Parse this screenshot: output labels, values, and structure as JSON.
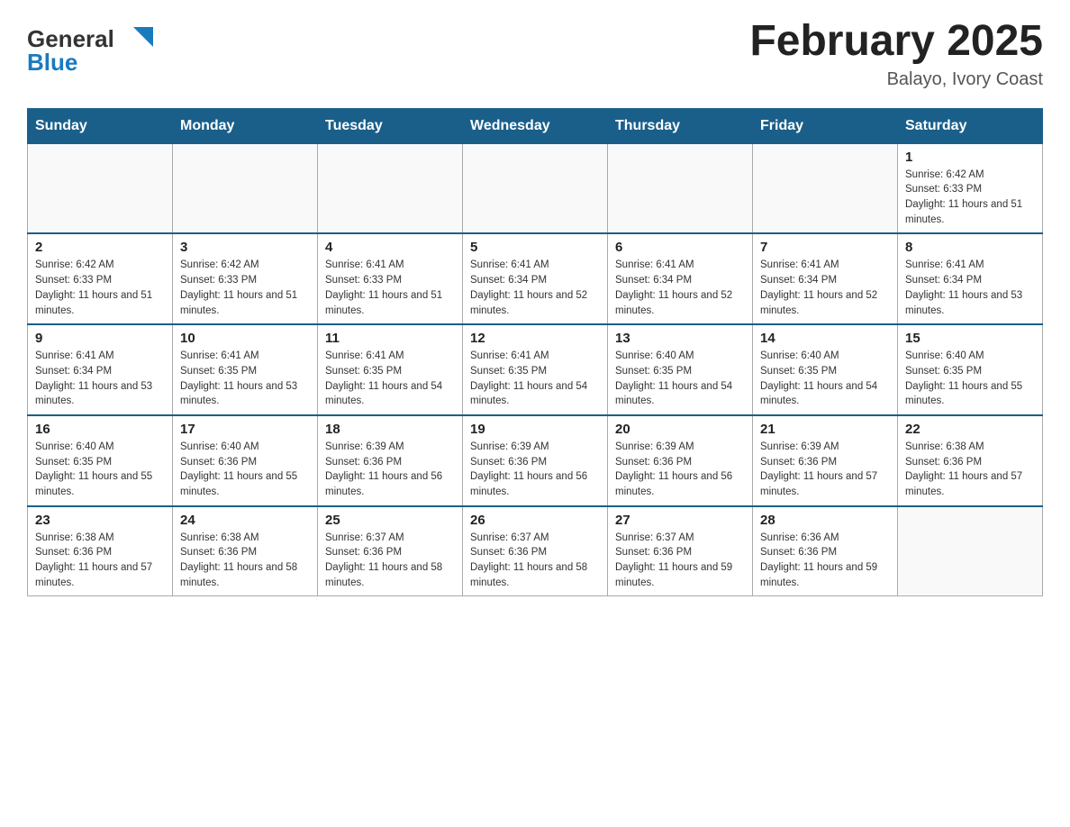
{
  "header": {
    "logo_general": "General",
    "logo_blue": "Blue",
    "month_title": "February 2025",
    "location": "Balayo, Ivory Coast"
  },
  "days_of_week": [
    "Sunday",
    "Monday",
    "Tuesday",
    "Wednesday",
    "Thursday",
    "Friday",
    "Saturday"
  ],
  "weeks": [
    [
      {
        "day": "",
        "sunrise": "",
        "sunset": "",
        "daylight": ""
      },
      {
        "day": "",
        "sunrise": "",
        "sunset": "",
        "daylight": ""
      },
      {
        "day": "",
        "sunrise": "",
        "sunset": "",
        "daylight": ""
      },
      {
        "day": "",
        "sunrise": "",
        "sunset": "",
        "daylight": ""
      },
      {
        "day": "",
        "sunrise": "",
        "sunset": "",
        "daylight": ""
      },
      {
        "day": "",
        "sunrise": "",
        "sunset": "",
        "daylight": ""
      },
      {
        "day": "1",
        "sunrise": "Sunrise: 6:42 AM",
        "sunset": "Sunset: 6:33 PM",
        "daylight": "Daylight: 11 hours and 51 minutes."
      }
    ],
    [
      {
        "day": "2",
        "sunrise": "Sunrise: 6:42 AM",
        "sunset": "Sunset: 6:33 PM",
        "daylight": "Daylight: 11 hours and 51 minutes."
      },
      {
        "day": "3",
        "sunrise": "Sunrise: 6:42 AM",
        "sunset": "Sunset: 6:33 PM",
        "daylight": "Daylight: 11 hours and 51 minutes."
      },
      {
        "day": "4",
        "sunrise": "Sunrise: 6:41 AM",
        "sunset": "Sunset: 6:33 PM",
        "daylight": "Daylight: 11 hours and 51 minutes."
      },
      {
        "day": "5",
        "sunrise": "Sunrise: 6:41 AM",
        "sunset": "Sunset: 6:34 PM",
        "daylight": "Daylight: 11 hours and 52 minutes."
      },
      {
        "day": "6",
        "sunrise": "Sunrise: 6:41 AM",
        "sunset": "Sunset: 6:34 PM",
        "daylight": "Daylight: 11 hours and 52 minutes."
      },
      {
        "day": "7",
        "sunrise": "Sunrise: 6:41 AM",
        "sunset": "Sunset: 6:34 PM",
        "daylight": "Daylight: 11 hours and 52 minutes."
      },
      {
        "day": "8",
        "sunrise": "Sunrise: 6:41 AM",
        "sunset": "Sunset: 6:34 PM",
        "daylight": "Daylight: 11 hours and 53 minutes."
      }
    ],
    [
      {
        "day": "9",
        "sunrise": "Sunrise: 6:41 AM",
        "sunset": "Sunset: 6:34 PM",
        "daylight": "Daylight: 11 hours and 53 minutes."
      },
      {
        "day": "10",
        "sunrise": "Sunrise: 6:41 AM",
        "sunset": "Sunset: 6:35 PM",
        "daylight": "Daylight: 11 hours and 53 minutes."
      },
      {
        "day": "11",
        "sunrise": "Sunrise: 6:41 AM",
        "sunset": "Sunset: 6:35 PM",
        "daylight": "Daylight: 11 hours and 54 minutes."
      },
      {
        "day": "12",
        "sunrise": "Sunrise: 6:41 AM",
        "sunset": "Sunset: 6:35 PM",
        "daylight": "Daylight: 11 hours and 54 minutes."
      },
      {
        "day": "13",
        "sunrise": "Sunrise: 6:40 AM",
        "sunset": "Sunset: 6:35 PM",
        "daylight": "Daylight: 11 hours and 54 minutes."
      },
      {
        "day": "14",
        "sunrise": "Sunrise: 6:40 AM",
        "sunset": "Sunset: 6:35 PM",
        "daylight": "Daylight: 11 hours and 54 minutes."
      },
      {
        "day": "15",
        "sunrise": "Sunrise: 6:40 AM",
        "sunset": "Sunset: 6:35 PM",
        "daylight": "Daylight: 11 hours and 55 minutes."
      }
    ],
    [
      {
        "day": "16",
        "sunrise": "Sunrise: 6:40 AM",
        "sunset": "Sunset: 6:35 PM",
        "daylight": "Daylight: 11 hours and 55 minutes."
      },
      {
        "day": "17",
        "sunrise": "Sunrise: 6:40 AM",
        "sunset": "Sunset: 6:36 PM",
        "daylight": "Daylight: 11 hours and 55 minutes."
      },
      {
        "day": "18",
        "sunrise": "Sunrise: 6:39 AM",
        "sunset": "Sunset: 6:36 PM",
        "daylight": "Daylight: 11 hours and 56 minutes."
      },
      {
        "day": "19",
        "sunrise": "Sunrise: 6:39 AM",
        "sunset": "Sunset: 6:36 PM",
        "daylight": "Daylight: 11 hours and 56 minutes."
      },
      {
        "day": "20",
        "sunrise": "Sunrise: 6:39 AM",
        "sunset": "Sunset: 6:36 PM",
        "daylight": "Daylight: 11 hours and 56 minutes."
      },
      {
        "day": "21",
        "sunrise": "Sunrise: 6:39 AM",
        "sunset": "Sunset: 6:36 PM",
        "daylight": "Daylight: 11 hours and 57 minutes."
      },
      {
        "day": "22",
        "sunrise": "Sunrise: 6:38 AM",
        "sunset": "Sunset: 6:36 PM",
        "daylight": "Daylight: 11 hours and 57 minutes."
      }
    ],
    [
      {
        "day": "23",
        "sunrise": "Sunrise: 6:38 AM",
        "sunset": "Sunset: 6:36 PM",
        "daylight": "Daylight: 11 hours and 57 minutes."
      },
      {
        "day": "24",
        "sunrise": "Sunrise: 6:38 AM",
        "sunset": "Sunset: 6:36 PM",
        "daylight": "Daylight: 11 hours and 58 minutes."
      },
      {
        "day": "25",
        "sunrise": "Sunrise: 6:37 AM",
        "sunset": "Sunset: 6:36 PM",
        "daylight": "Daylight: 11 hours and 58 minutes."
      },
      {
        "day": "26",
        "sunrise": "Sunrise: 6:37 AM",
        "sunset": "Sunset: 6:36 PM",
        "daylight": "Daylight: 11 hours and 58 minutes."
      },
      {
        "day": "27",
        "sunrise": "Sunrise: 6:37 AM",
        "sunset": "Sunset: 6:36 PM",
        "daylight": "Daylight: 11 hours and 59 minutes."
      },
      {
        "day": "28",
        "sunrise": "Sunrise: 6:36 AM",
        "sunset": "Sunset: 6:36 PM",
        "daylight": "Daylight: 11 hours and 59 minutes."
      },
      {
        "day": "",
        "sunrise": "",
        "sunset": "",
        "daylight": ""
      }
    ]
  ]
}
